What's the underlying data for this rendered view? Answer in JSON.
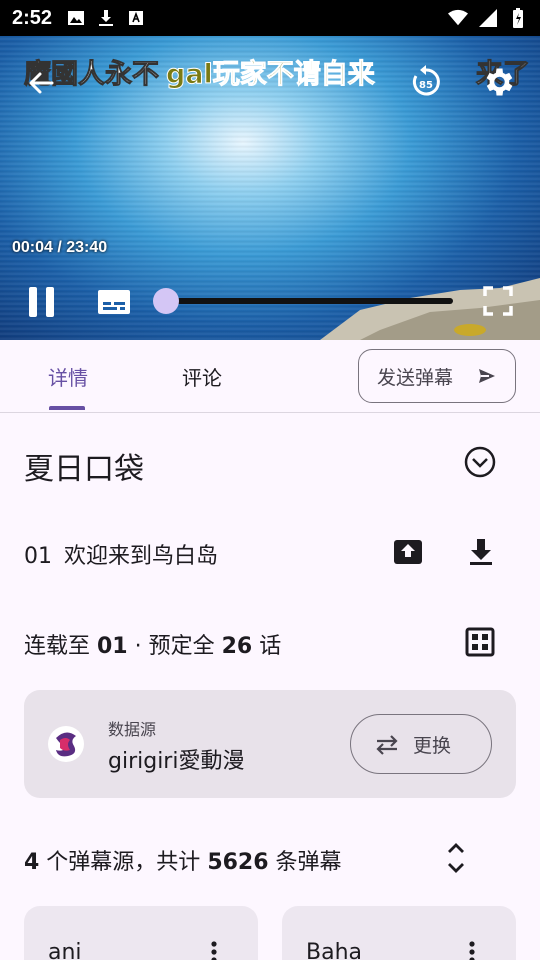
{
  "status_bar": {
    "time": "2:52"
  },
  "player": {
    "danmaku": [
      "魔國人永不",
      "gal玩家不请自来",
      "来了"
    ],
    "time": "00:04 / 23:40",
    "progress": 0.003,
    "replay_seconds": "85"
  },
  "tabs": {
    "details": "详情",
    "comments": "评论",
    "send_danmaku": "发送弹幕"
  },
  "anime": {
    "title": "夏日口袋",
    "episode_number": "01",
    "episode_title": "欢迎来到鸟白岛",
    "status_prefix": "连载至 ",
    "status_ep": "01",
    "status_mid": " · 预定全 ",
    "status_total": "26",
    "status_suffix": " 话"
  },
  "source": {
    "label": "数据源",
    "name": "girigiri愛動漫",
    "change_label": "更换"
  },
  "danmaku_summary": {
    "count_sources": "4",
    "text1": " 个弹幕源，共计 ",
    "count_total": "5626",
    "text2": " 条弹幕"
  },
  "danmaku_sources": [
    {
      "name": "ani"
    },
    {
      "name": "Baha"
    }
  ],
  "colors": {
    "accent": "#6750a4",
    "surface": "#fdf7ff",
    "card": "#e8e2ea"
  }
}
